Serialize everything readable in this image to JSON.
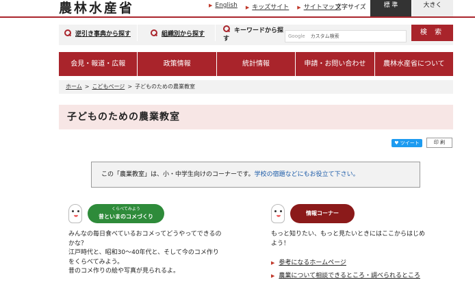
{
  "header": {
    "logo": "農林水産省",
    "links": [
      "English",
      "キッズサイト",
      "サイトマップ"
    ],
    "font_size_label": "文字サイズ",
    "font_standard": "標 準",
    "font_large": "大きく"
  },
  "searchbar": {
    "reverse_dict": "逆引き事典から探す",
    "by_org": "組織別から探す",
    "keyword_label": "キーワードから探す",
    "google": "Google",
    "placeholder": "カスタム検索",
    "search_button": "検 索"
  },
  "nav": [
    "会見・報道・広報",
    "政策情報",
    "統計情報",
    "申請・お問い合わせ",
    "農林水産省について"
  ],
  "breadcrumb": {
    "home": "ホーム",
    "kids": "こどもページ",
    "current": "子どものための農業教室"
  },
  "page_title": "子どものための農業教室",
  "share": {
    "tweet": "ツイート",
    "print": "印 刷"
  },
  "notice": {
    "text": "この「農業教室」は、小・中学生向けのコーナーです。",
    "highlight": "学校の宿題などにもお役立て下さい。"
  },
  "left": {
    "badge_small": "くらべてみよう",
    "badge_big": "昔といまのコメづくり",
    "text": "みんなの毎日食べているおコメってどうやってできるの\nかな？\n江戸時代と、昭和30〜40年代と、そして今のコメ作り\nをくらべてみよう。\n昔のコメ作りの絵や写真が見られるよ。"
  },
  "right": {
    "badge": "情報コーナー",
    "text": "もっと知りたい、もっと見たいときにはここからはじめ\nよう！",
    "links": [
      "参考になるホームページ",
      "農業について相談できるところ・調べられるところ"
    ]
  }
}
